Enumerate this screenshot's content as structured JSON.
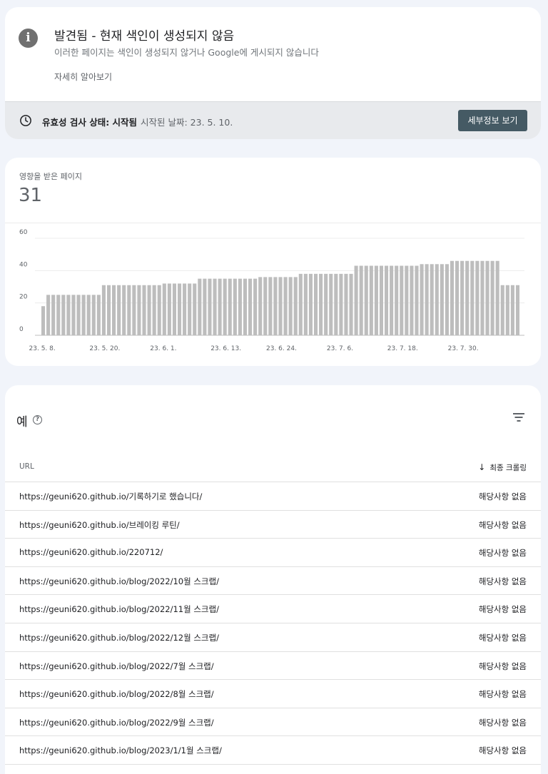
{
  "issue": {
    "icon": "info-icon",
    "title": "발견됨 - 현재 색인이 생성되지 않음",
    "description": "이러한 페이지는 색인이 생성되지 않거나 Google에 게시되지 않습니다",
    "learn_more": "자세히 알아보기"
  },
  "validation": {
    "icon": "clock-icon",
    "label": "유효성 검사 상태: 시작됨",
    "started": "시작된 날짜: 23. 5. 10.",
    "details_button": "세부정보 보기"
  },
  "metric": {
    "label": "영향을 받은 페이지",
    "value": "31"
  },
  "chart_data": {
    "type": "bar",
    "title": "",
    "xlabel": "",
    "ylabel": "",
    "ylim": [
      0,
      60
    ],
    "yticks": [
      0,
      20,
      40,
      60
    ],
    "grid": true,
    "bar_color": "#bdbdbd",
    "x_tick_labels": [
      {
        "label": "23. 5. 8.",
        "index": 0
      },
      {
        "label": "23. 5. 20.",
        "index": 12
      },
      {
        "label": "23. 6. 1.",
        "index": 24
      },
      {
        "label": "23. 6. 13.",
        "index": 36
      },
      {
        "label": "23. 6. 24.",
        "index": 47
      },
      {
        "label": "23. 7. 6.",
        "index": 59
      },
      {
        "label": "23. 7. 18.",
        "index": 71
      },
      {
        "label": "23. 7. 30.",
        "index": 83
      }
    ],
    "values": [
      18,
      25,
      25,
      25,
      25,
      25,
      25,
      25,
      25,
      25,
      25,
      25,
      31,
      31,
      31,
      31,
      31,
      31,
      31,
      31,
      31,
      31,
      31,
      31,
      32,
      32,
      32,
      32,
      32,
      32,
      32,
      35,
      35,
      35,
      35,
      35,
      35,
      35,
      35,
      35,
      35,
      35,
      35,
      36,
      36,
      36,
      36,
      36,
      36,
      36,
      36,
      38,
      38,
      38,
      38,
      38,
      38,
      38,
      38,
      38,
      38,
      38,
      43,
      43,
      43,
      43,
      43,
      43,
      43,
      43,
      43,
      43,
      43,
      43,
      43,
      44,
      44,
      44,
      44,
      44,
      44,
      46,
      46,
      46,
      46,
      46,
      46,
      46,
      46,
      46,
      46,
      31,
      31,
      31,
      31
    ]
  },
  "examples": {
    "title": "예",
    "help_icon": "help-icon",
    "filter_icon": "filter-icon",
    "col_url": "URL",
    "col_crawl": "최종 크롤링",
    "rows": [
      {
        "url": "https://geuni620.github.io/기록하기로 했습니다/",
        "crawl": "해당사항 없음"
      },
      {
        "url": "https://geuni620.github.io/브레이킹 루틴/",
        "crawl": "해당사항 없음"
      },
      {
        "url": "https://geuni620.github.io/220712/",
        "crawl": "해당사항 없음"
      },
      {
        "url": "https://geuni620.github.io/blog/2022/10월 스크랩/",
        "crawl": "해당사항 없음"
      },
      {
        "url": "https://geuni620.github.io/blog/2022/11월 스크랩/",
        "crawl": "해당사항 없음"
      },
      {
        "url": "https://geuni620.github.io/blog/2022/12월 스크랩/",
        "crawl": "해당사항 없음"
      },
      {
        "url": "https://geuni620.github.io/blog/2022/7월 스크랩/",
        "crawl": "해당사항 없음"
      },
      {
        "url": "https://geuni620.github.io/blog/2022/8월 스크랩/",
        "crawl": "해당사항 없음"
      },
      {
        "url": "https://geuni620.github.io/blog/2022/9월 스크랩/",
        "crawl": "해당사항 없음"
      },
      {
        "url": "https://geuni620.github.io/blog/2023/1/1월 스크랩/",
        "crawl": "해당사항 없음"
      }
    ]
  }
}
